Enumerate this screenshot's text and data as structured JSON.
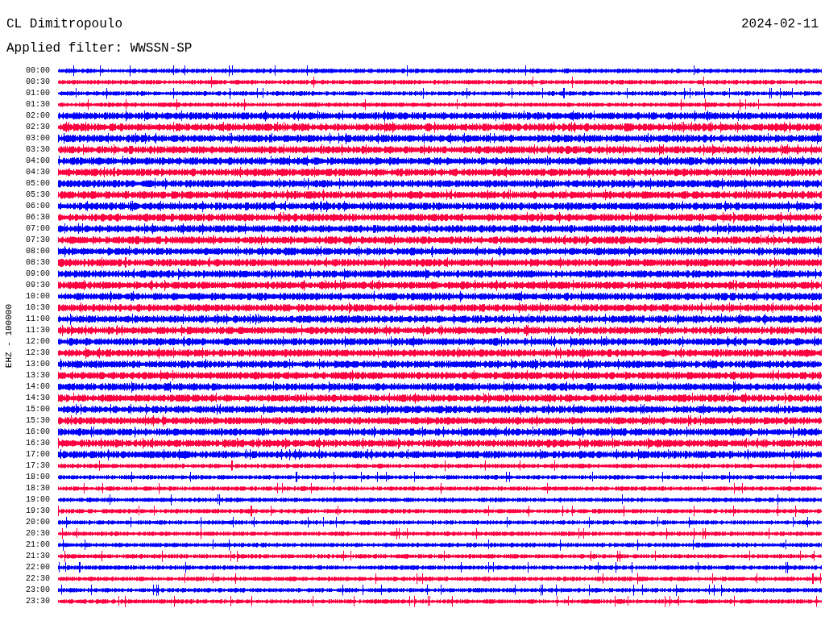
{
  "station": "CL Dimitropoulo",
  "filter_label": "Applied filter: WWSSN-SP",
  "date": "2024-02-11",
  "channel_label": "EHZ - 100000",
  "rows": [
    {
      "time": "00:00",
      "color": "#0000ff"
    },
    {
      "time": "00:30",
      "color": "#ff0040"
    },
    {
      "time": "01:00",
      "color": "#0000ff"
    },
    {
      "time": "01:30",
      "color": "#ff0040"
    },
    {
      "time": "02:00",
      "color": "#0000ff"
    },
    {
      "time": "02:30",
      "color": "#ff0040"
    },
    {
      "time": "03:00",
      "color": "#0000ff"
    },
    {
      "time": "03:30",
      "color": "#ff0040"
    },
    {
      "time": "04:00",
      "color": "#0000ff"
    },
    {
      "time": "04:30",
      "color": "#ff0040"
    },
    {
      "time": "05:00",
      "color": "#0000ff"
    },
    {
      "time": "05:30",
      "color": "#ff0040"
    },
    {
      "time": "06:00",
      "color": "#0000ff"
    },
    {
      "time": "06:30",
      "color": "#ff0040"
    },
    {
      "time": "07:00",
      "color": "#0000ff"
    },
    {
      "time": "07:30",
      "color": "#ff0040"
    },
    {
      "time": "08:00",
      "color": "#0000ff"
    },
    {
      "time": "08:30",
      "color": "#ff0040"
    },
    {
      "time": "09:00",
      "color": "#0000ff"
    },
    {
      "time": "09:30",
      "color": "#ff0040"
    },
    {
      "time": "10:00",
      "color": "#0000ff"
    },
    {
      "time": "10:30",
      "color": "#ff0040"
    },
    {
      "time": "11:00",
      "color": "#0000ff"
    },
    {
      "time": "11:30",
      "color": "#ff0040"
    },
    {
      "time": "12:00",
      "color": "#0000ff"
    },
    {
      "time": "12:30",
      "color": "#ff0040"
    },
    {
      "time": "13:00",
      "color": "#0000ff"
    },
    {
      "time": "13:30",
      "color": "#ff0040"
    },
    {
      "time": "14:00",
      "color": "#0000ff"
    },
    {
      "time": "14:30",
      "color": "#ff0040"
    },
    {
      "time": "15:00",
      "color": "#0000ff"
    },
    {
      "time": "15:30",
      "color": "#ff0040"
    },
    {
      "time": "16:00",
      "color": "#0000ff"
    },
    {
      "time": "16:30",
      "color": "#ff0040"
    },
    {
      "time": "17:00",
      "color": "#0000ff"
    },
    {
      "time": "17:30",
      "color": "#ff0040"
    },
    {
      "time": "18:00",
      "color": "#0000ff"
    },
    {
      "time": "18:30",
      "color": "#ff0040"
    },
    {
      "time": "19:00",
      "color": "#0000ff"
    },
    {
      "time": "19:30",
      "color": "#ff0040"
    },
    {
      "time": "20:00",
      "color": "#0000ff"
    },
    {
      "time": "20:30",
      "color": "#ff0040"
    },
    {
      "time": "21:00",
      "color": "#0000ff"
    },
    {
      "time": "21:30",
      "color": "#ff0040"
    },
    {
      "time": "22:00",
      "color": "#0000ff"
    },
    {
      "time": "22:30",
      "color": "#ff0040"
    },
    {
      "time": "23:00",
      "color": "#0000ff"
    },
    {
      "time": "23:30",
      "color": "#ff0040"
    }
  ]
}
